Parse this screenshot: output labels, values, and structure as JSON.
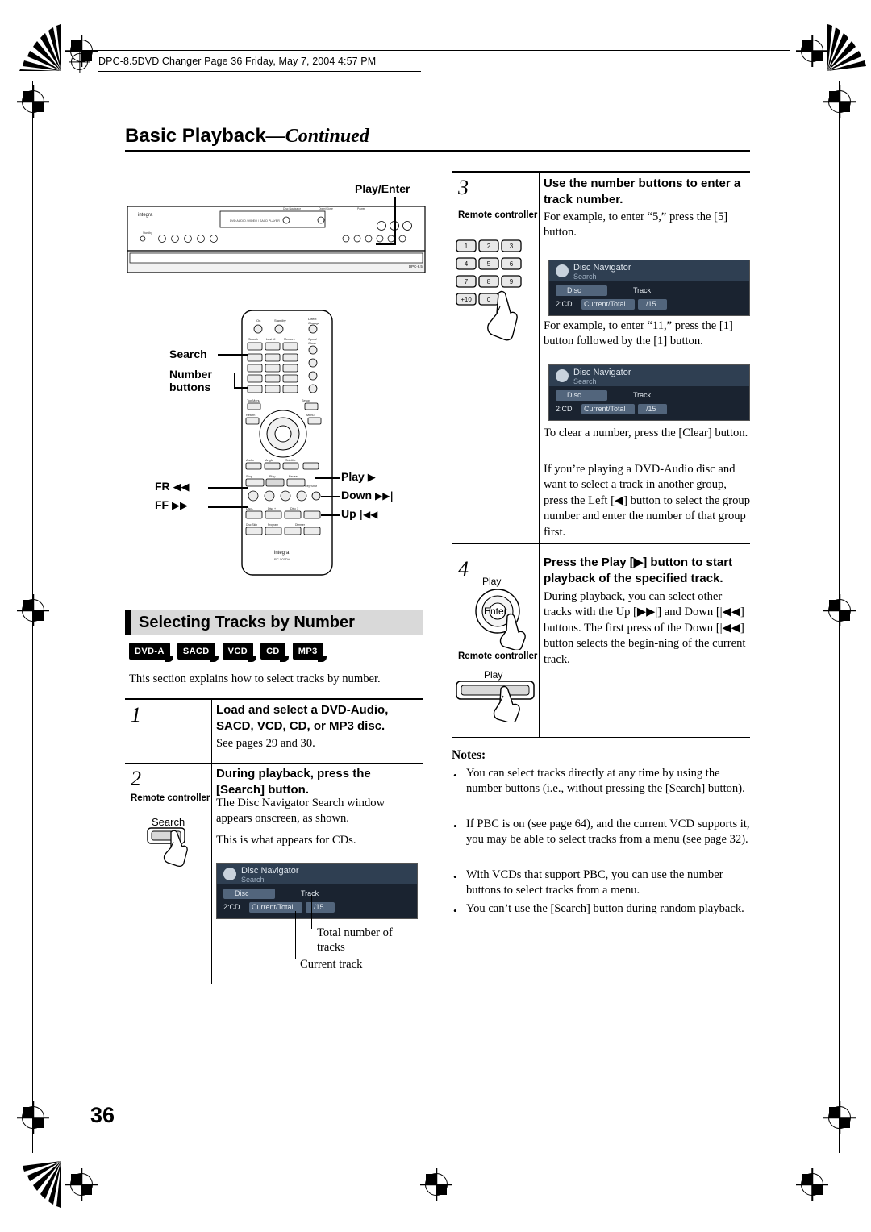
{
  "header": {
    "running_head": "DPC-8.5DVD Changer  Page 36  Friday, May 7, 2004  4:57 PM"
  },
  "title": {
    "main": "Basic Playback",
    "continued": "—Continued"
  },
  "page_number": "36",
  "left_column": {
    "illustration_callouts": {
      "play_enter": "Play/Enter",
      "search": "Search",
      "number": "Number",
      "buttons": "buttons",
      "fr": "FR",
      "ff": "FF",
      "play": "Play",
      "down": "Down",
      "up": "Up",
      "fr_glyph": "◀◀",
      "ff_glyph": "▶▶",
      "play_glyph": "▶",
      "down_glyph": "▶▶|",
      "up_glyph": "|◀◀",
      "brand": "integra",
      "model": "DPC-8.5",
      "remote_model": "RC-507DV"
    },
    "section_heading": "Selecting Tracks by Number",
    "badges": [
      "DVD-A",
      "SACD",
      "VCD",
      "CD",
      "MP3"
    ],
    "intro": "This section explains how to select tracks by number.",
    "steps": [
      {
        "number": "1",
        "heading": "Load and select a DVD-Audio, SACD, VCD, CD, or MP3 disc.",
        "body": "See pages 29 and 30."
      },
      {
        "number": "2",
        "heading": "During playback, press the [Search] button.",
        "remote_label": "Remote controller",
        "key_label": "Search",
        "body1": "The Disc Navigator Search window appears onscreen, as shown.",
        "body2": "This is what appears for CDs."
      }
    ],
    "osd": {
      "title": "Disc Navigator",
      "subtitle": "Search",
      "disc_label": "Disc",
      "track_label": "Track",
      "disc_value": "2:CD",
      "current_total_label": "Current/Total",
      "current_total_value": "/15"
    },
    "osd_callouts": {
      "total": "Total number of",
      "total2": "tracks",
      "current": "Current track"
    }
  },
  "right_column": {
    "steps": [
      {
        "number": "3",
        "heading": "Use the number buttons to enter a track number.",
        "remote_label": "Remote controller",
        "body1": "For example, to enter “5,” press the [5] button.",
        "body2": "For example, to enter “11,” press the [1] button followed by the [1] button.",
        "body3": "To clear a number, press the [Clear] button.",
        "body4": "If you’re playing a DVD-Audio disc and want to select a track in another group, press the Left [◀] button to select the group number and enter the number of that group first.",
        "keys": [
          "1",
          "2",
          "3",
          "4",
          "5",
          "6",
          "7",
          "8",
          "9",
          "+10",
          "0"
        ]
      },
      {
        "number": "4",
        "heading": "Press the Play [▶] button to start playback of the specified track.",
        "key_play": "Play",
        "key_enter": "Enter",
        "remote_label": "Remote controller",
        "key_play2": "Play",
        "body1": "During playback, you can select other tracks with the Up [▶▶|] and Down [|◀◀] buttons. The first press of the Down [|◀◀] button selects the begin-ning of the current track."
      }
    ],
    "osd1": {
      "title": "Disc Navigator",
      "subtitle": "Search",
      "disc_label": "Disc",
      "track_label": "Track",
      "disc_value": "2:CD",
      "current_total_label": "Current/Total",
      "current_total_value": "/15"
    },
    "osd2": {
      "title": "Disc Navigator",
      "subtitle": "Search",
      "disc_label": "Disc",
      "track_label": "Track",
      "disc_value": "2:CD",
      "current_total_label": "Current/Total",
      "current_total_value": "/15"
    },
    "notes_title": "Notes:",
    "notes": [
      "You can select tracks directly at any time by using the number buttons (i.e., without pressing the [Search] button).",
      "If PBC is on (see page 64), and the current VCD supports it, you may be able to select tracks from a menu (see page 32).",
      "With VCDs that support PBC, you can use the number buttons to select tracks from a menu.",
      "You can’t use the [Search] button during random playback."
    ]
  }
}
